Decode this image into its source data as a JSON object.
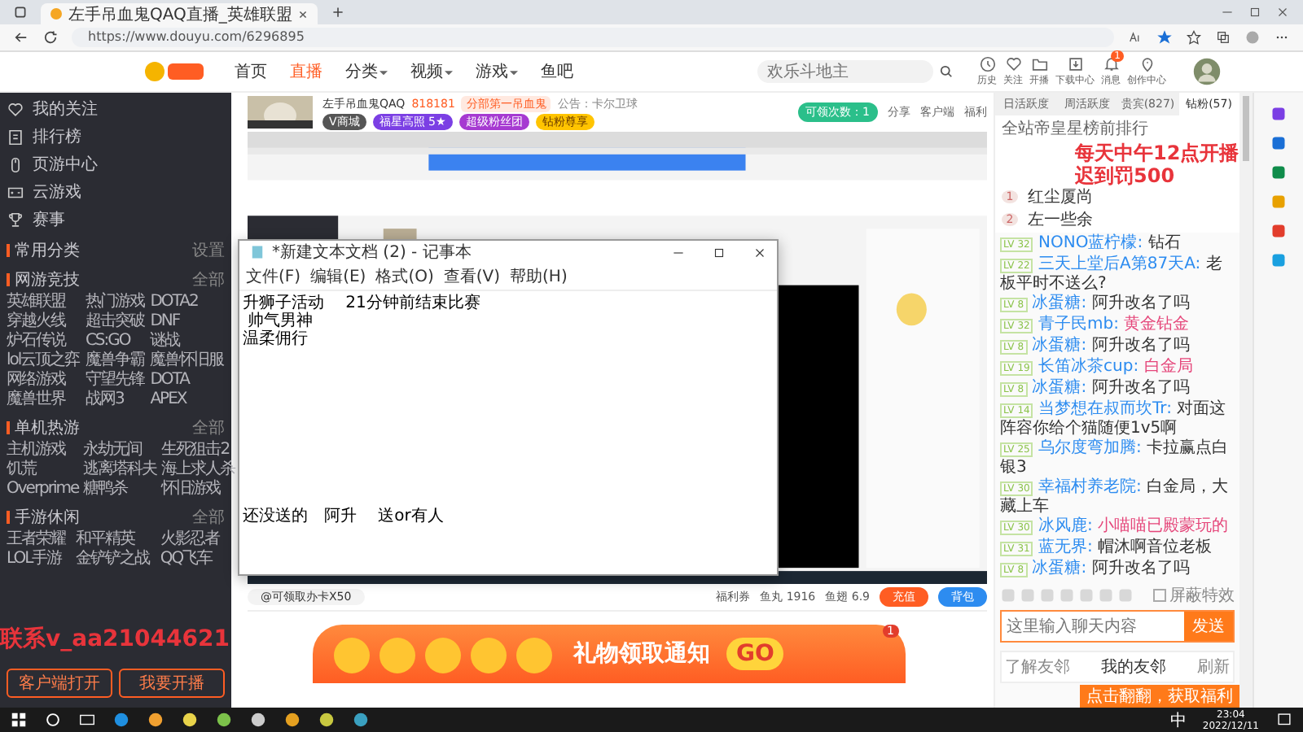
{
  "browser": {
    "tab_title": "左手吊血鬼QAQ直播_英雄联盟",
    "url": "https://www.douyu.com/6296895"
  },
  "header": {
    "nav": [
      {
        "label": "首页",
        "selected": false,
        "has_menu": false
      },
      {
        "label": "直播",
        "selected": true,
        "has_menu": false
      },
      {
        "label": "分类",
        "selected": false,
        "has_menu": true
      },
      {
        "label": "视频",
        "selected": false,
        "has_menu": true
      },
      {
        "label": "游戏",
        "selected": false,
        "has_menu": true
      },
      {
        "label": "鱼吧",
        "selected": false,
        "has_menu": false
      }
    ],
    "search": {
      "placeholder": "欢乐斗地主"
    },
    "icons": [
      {
        "label": "历史",
        "kind": "clock"
      },
      {
        "label": "关注",
        "kind": "heart"
      },
      {
        "label": "开播",
        "kind": "folder"
      },
      {
        "label": "下载中心",
        "kind": "download"
      },
      {
        "label": "消息",
        "kind": "bell",
        "badge": "1"
      },
      {
        "label": "创作中心",
        "kind": "pin"
      }
    ]
  },
  "sidebar": {
    "nav": [
      {
        "label": "我的关注",
        "kind": "heart"
      },
      {
        "label": "排行榜",
        "kind": "list"
      },
      {
        "label": "页游中心",
        "kind": "mouse"
      },
      {
        "label": "云游戏",
        "kind": "gamepad"
      },
      {
        "label": "赛事",
        "kind": "trophy"
      }
    ],
    "sections": [
      {
        "title": "常用分类",
        "more": "设置"
      },
      {
        "title": "网游竞技",
        "more": "全部",
        "items": [
          "英雄联盟",
          "热门游戏",
          "DOTA2",
          "穿越火线",
          "超击突破",
          "DNF",
          "炉石传说",
          "CS:GO",
          "谜战",
          "lol云顶之弈",
          "魔兽争霸",
          "魔兽怀旧服",
          "网络游戏",
          "守望先锋",
          "DOTA",
          "魔兽世界",
          "战网3",
          "APEX"
        ]
      },
      {
        "title": "单机热游",
        "more": "全部",
        "items": [
          "主机游戏",
          "永劫无间",
          "生死狙击2",
          "饥荒",
          "逃离塔科夫",
          "海上求人杀",
          "Overprime",
          "糖鸭杀",
          "怀旧游戏"
        ]
      },
      {
        "title": "手游休闲",
        "more": "全部",
        "items": [
          "王者荣耀",
          "和平精英",
          "火影忍者",
          "LOL手游",
          "金铲铲之战",
          "QQ飞车"
        ]
      }
    ],
    "buttons": [
      "客户端打开",
      "我要开播"
    ]
  },
  "streamer": {
    "name": "左手吊血鬼QAQ",
    "heat": "818181",
    "tag": "分部第一吊血鬼",
    "notice": "公告：卡尔卫球",
    "badges": [
      "V商城",
      "福星高照 5★",
      "超级粉丝团",
      "钻粉尊享"
    ],
    "claim": "可领次数：1",
    "actions": [
      "分享",
      "客户端",
      "福利"
    ]
  },
  "notepad": {
    "title": "*新建文本文档 (2) - 记事本",
    "menus": [
      "文件(F)",
      "编辑(E)",
      "格式(O)",
      "查看(V)",
      "帮助(H)"
    ],
    "top_lines": [
      "升狮子活动　 21分钟前结束比赛",
      " 帅气男神",
      "温柔佣行"
    ],
    "bottom_line": "还没送的　阿升　 送or有人"
  },
  "gift_bar": {
    "notice": "@可领取办卡X50",
    "welfare": "福利券",
    "fish_balls": "鱼丸 1916",
    "fish_fins": "鱼翅 6.9",
    "recharge": "充值",
    "backpack": "背包"
  },
  "banner": {
    "text": "礼物领取通知",
    "go": "GO",
    "badge": "1"
  },
  "chat": {
    "tabs": [
      {
        "label": "日活跃度",
        "selected": false
      },
      {
        "label": "周活跃度",
        "selected": false
      },
      {
        "label": "贵宾(827)",
        "selected": false
      },
      {
        "label": "钻粉(57)",
        "selected": true
      }
    ],
    "rank_title": "全站帝皇星榜前排行",
    "ranks": [
      {
        "rank": "1",
        "name": "红尘厦尚"
      },
      {
        "rank": "2",
        "name": "左一些余"
      }
    ],
    "messages": [
      {
        "level": "LV 32",
        "user": "NONO蓝柠檬:",
        "text": "钻石",
        "highlight": false
      },
      {
        "level": "LV 22",
        "user": "三天上堂后A第87天A:",
        "text": "老板平时不送么?",
        "highlight": false
      },
      {
        "level": "LV 8",
        "user": "冰蛋糖:",
        "text": "阿升改名了吗",
        "highlight": false
      },
      {
        "level": "LV 32",
        "user": "青子民mb:",
        "text": "黄金钻金",
        "highlight": true
      },
      {
        "level": "LV 8",
        "user": "冰蛋糖:",
        "text": "阿升改名了吗",
        "highlight": false
      },
      {
        "level": "LV 19",
        "user": "长笛冰茶cup:",
        "text": "白金局",
        "highlight": true
      },
      {
        "level": "LV 8",
        "user": "冰蛋糖:",
        "text": "阿升改名了吗",
        "highlight": false
      },
      {
        "level": "LV 14",
        "user": "当梦想在叔而坎Tr:",
        "text": "对面这阵容你给个猫随便1v5啊",
        "highlight": false
      },
      {
        "level": "LV 25",
        "user": "乌尔度弯加腾:",
        "text": "卡拉赢点白银3",
        "highlight": false
      },
      {
        "level": "LV 30",
        "user": "幸福村养老院:",
        "text": "白金局，大藏上车",
        "highlight": false
      },
      {
        "level": "LV 30",
        "user": "冰风鹿:",
        "text": "小喵喵已殿蒙玩的",
        "highlight": true
      },
      {
        "level": "LV 31",
        "user": "蓝无界:",
        "text": "帽沐啊音位老板",
        "highlight": false
      },
      {
        "level": "LV 8",
        "user": "冰蛋糖:",
        "text": "阿升改名了吗",
        "highlight": false
      }
    ],
    "input_placeholder": "这里输入聊天内容",
    "send": "发送",
    "block_effects": {
      "label": "屏蔽特效",
      "checked": false
    },
    "friends": {
      "about": "了解友邻",
      "title": "我的友邻",
      "refresh": "刷新"
    },
    "toast": "点击翻翻，获取福利"
  },
  "overlays": [
    {
      "kind": "schedule",
      "lines": [
        "每天中午12点开播",
        "迟到罚500"
      ]
    },
    {
      "kind": "contact",
      "lines": [
        "联系v_aa21044621"
      ]
    }
  ],
  "taskbar": {
    "ime": "中",
    "time": "23:04",
    "date": "2022/12/11"
  }
}
